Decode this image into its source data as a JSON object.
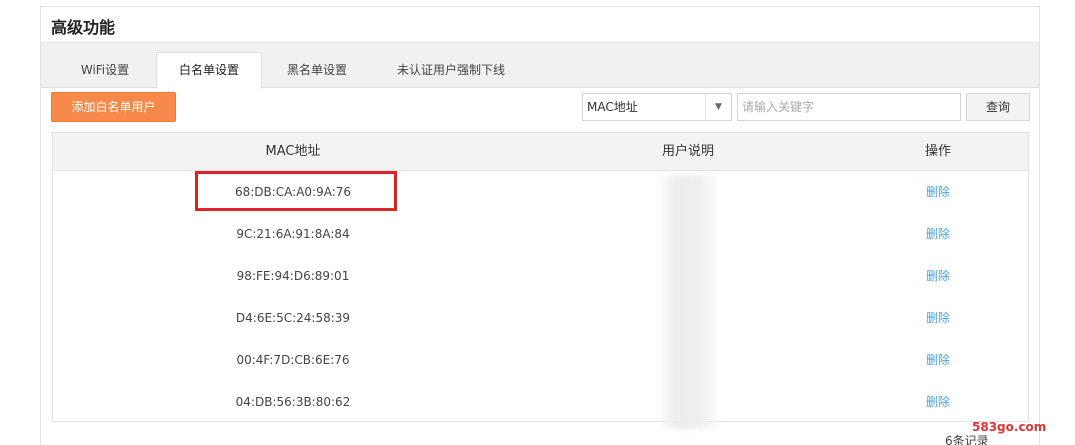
{
  "page_title": "高级功能",
  "tabs": [
    {
      "label": "WiFi设置",
      "active": false
    },
    {
      "label": "白名单设置",
      "active": true
    },
    {
      "label": "黑名单设置",
      "active": false
    },
    {
      "label": "未认证用户强制下线",
      "active": false
    }
  ],
  "toolbar": {
    "add_button_label": "添加白名单用户",
    "filter_selected": "MAC地址",
    "search_placeholder": "请输入关键字",
    "query_button_label": "查询"
  },
  "table": {
    "columns": [
      "MAC地址",
      "用户说明",
      "操作"
    ],
    "rows": [
      {
        "mac": "68:DB:CA:A0:9A:76",
        "desc": "",
        "action": "删除"
      },
      {
        "mac": "9C:21:6A:91:8A:84",
        "desc": "",
        "action": "删除"
      },
      {
        "mac": "98:FE:94:D6:89:01",
        "desc": "",
        "action": "删除"
      },
      {
        "mac": "D4:6E:5C:24:58:39",
        "desc": "",
        "action": "删除"
      },
      {
        "mac": "00:4F:7D:CB:6E:76",
        "desc": "",
        "action": "删除"
      },
      {
        "mac": "04:DB:56:3B:80:62",
        "desc": "",
        "action": "删除"
      }
    ]
  },
  "footer": {
    "record_count": "6条记录"
  },
  "watermark": "583go.com",
  "colors": {
    "accent_orange": "#f7894a",
    "link_blue": "#48a3e6",
    "highlight_red": "#d9252a"
  }
}
